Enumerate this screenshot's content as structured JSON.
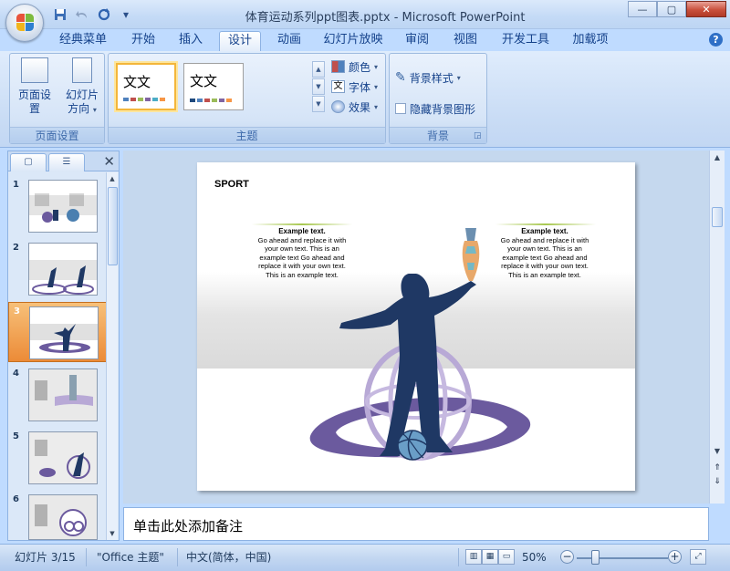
{
  "window": {
    "title": "体育运动系列ppt图表.pptx - Microsoft PowerPoint",
    "controls": {
      "minimize": "—",
      "maximize": "▢",
      "close": "✕"
    }
  },
  "quick_access": {
    "save": "save-icon",
    "undo": "undo-icon",
    "redo": "redo-icon",
    "customize": "▾"
  },
  "tabs": [
    {
      "label": "经典菜单",
      "active": false
    },
    {
      "label": "开始",
      "active": false
    },
    {
      "label": "插入",
      "active": false
    },
    {
      "label": "设计",
      "active": true
    },
    {
      "label": "动画",
      "active": false
    },
    {
      "label": "幻灯片放映",
      "active": false
    },
    {
      "label": "审阅",
      "active": false
    },
    {
      "label": "视图",
      "active": false
    },
    {
      "label": "开发工具",
      "active": false
    },
    {
      "label": "加载项",
      "active": false
    }
  ],
  "help": "?",
  "ribbon": {
    "page_setup": {
      "label": "页面设置",
      "page_setup_btn": "页面设置",
      "orientation_btn_line1": "幻灯片",
      "orientation_btn_line2": "方向"
    },
    "themes": {
      "label": "主题",
      "thumb1_text": "文文",
      "thumb2_text": "文文",
      "colors": "颜色",
      "fonts": "字体",
      "effects": "效果"
    },
    "background": {
      "label": "背景",
      "styles": "背景样式",
      "hide_graphics": "隐藏背景图形"
    }
  },
  "slides": {
    "numbers": [
      "1",
      "2",
      "3",
      "4",
      "5",
      "6"
    ],
    "selected": 3
  },
  "slide": {
    "heading": "SPORT",
    "left_block": {
      "title": "Example text.",
      "body": "Go ahead  and  replace it with your own text. This is an example text  Go ahead  and  replace it with your own text. This is an example  text."
    },
    "right_block": {
      "title": "Example text.",
      "body": "Go ahead  and  replace it with your own text. This is an example text  Go ahead  and  replace it with your own text. This is an example  text."
    }
  },
  "notes": {
    "placeholder": "单击此处添加备注"
  },
  "status": {
    "slide_counter": "幻灯片 3/15",
    "theme": "\"Office 主题\"",
    "language": "中文(简体，中国)",
    "zoom": "50%"
  },
  "colors": {
    "accent_orange": "#ec8b37",
    "silhouette": "#1f3864",
    "ring_purple": "#6b5a9e",
    "ring_light": "#b8a9d6",
    "ball": "#6a9ec7"
  }
}
